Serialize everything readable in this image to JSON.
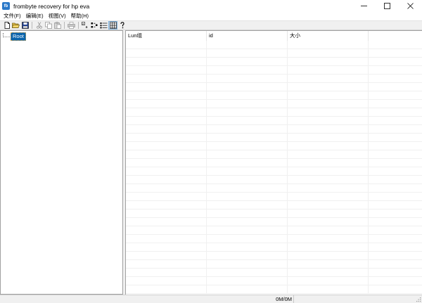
{
  "window": {
    "title": "frombyte recovery for hp eva",
    "app_icon_text": "fb"
  },
  "menu": [
    "文件(F)",
    "编辑(E)",
    "视图(V)",
    "帮助(H)"
  ],
  "toolbar": {
    "buttons": [
      {
        "icon": "new-file-icon"
      },
      {
        "icon": "open-folder-icon"
      },
      {
        "icon": "save-icon"
      },
      {
        "icon": "cut-icon"
      },
      {
        "icon": "copy-icon"
      },
      {
        "icon": "paste-icon"
      },
      {
        "icon": "print-icon"
      },
      {
        "icon": "large-icons-view-icon"
      },
      {
        "icon": "small-icons-view-icon"
      },
      {
        "icon": "list-view-icon"
      },
      {
        "icon": "details-view-icon"
      },
      {
        "icon": "help-icon"
      }
    ]
  },
  "tree": {
    "root_label": "Root"
  },
  "list": {
    "columns": [
      "Lun组",
      "id",
      "大小",
      ""
    ]
  },
  "status": {
    "progress_text": "0M/0M"
  },
  "colors": {
    "selection": "#0a64ad",
    "toolbar_bg": "#f0f0f0",
    "accent": "#2b79c9"
  }
}
